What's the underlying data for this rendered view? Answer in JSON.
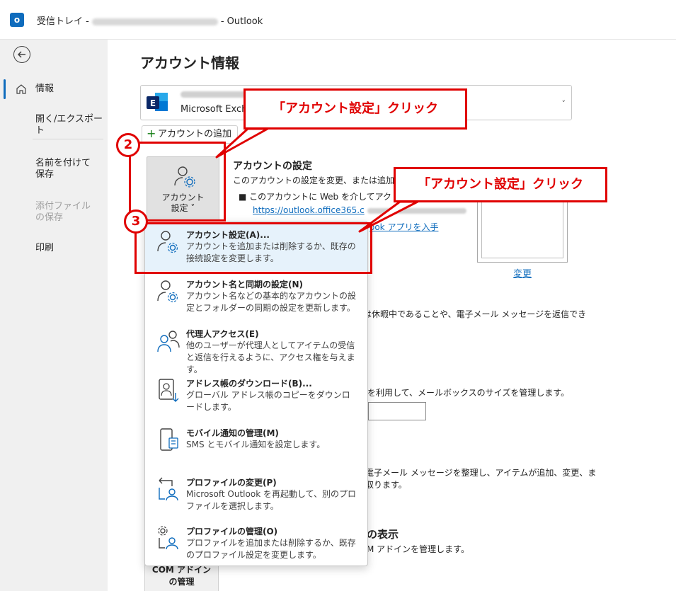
{
  "window": {
    "title_prefix": "受信トレイ -",
    "title_suffix": "-  Outlook"
  },
  "nav": {
    "back_label": "",
    "items": [
      {
        "label": "情報"
      },
      {
        "label": "開く/エクスポート"
      },
      {
        "label": "名前を付けて保存"
      },
      {
        "label": "添付ファイルの保存"
      },
      {
        "label": "印刷"
      }
    ]
  },
  "main": {
    "page_title": "アカウント情報",
    "account_type": "Microsoft Exch",
    "add_account": "アカウントの追加",
    "account_settings_button": {
      "line1": "アカウント",
      "line2": "設定 ˅"
    },
    "account_settings_section": {
      "title": "アカウントの設定",
      "desc": "このアカウントの設定を変更、または追加の",
      "bullet": "■   このアカウントに Web を介してアク",
      "link": "https://outlook.office365.c",
      "link2": "ook アプリを入手"
    },
    "change_link": "変更",
    "auto_reply_text_1": "は休暇中であることや、電子メール メッセージを返信でき",
    "auto_reply_text_2": "。",
    "mailbox_text": "を利用して、メールボックスのサイズを管理します。",
    "rules_text_1": "電子メール メッセージを整理し、アイテムが追加、変更、ま",
    "rules_text_2": "取ります。",
    "com_title": "の表示",
    "com_desc": "M アドインを管理します。",
    "com_button": {
      "line1": "COM アドイン",
      "line2": "の管理"
    }
  },
  "menu": {
    "items": [
      {
        "title": "アカウント設定(A)...",
        "desc": "アカウントを追加または削除するか、既存の接続設定を変更します。"
      },
      {
        "title": "アカウント名と同期の設定(N)",
        "desc": "アカウント名などの基本的なアカウントの設定とフォルダーの同期の設定を更新します。"
      },
      {
        "title": "代理人アクセス(E)",
        "desc": "他のユーザーが代理人としてアイテムの受信と返信を行えるように、アクセス権を与えます。"
      },
      {
        "title": "アドレス帳のダウンロード(B)...",
        "desc": "グローバル アドレス帳のコピーをダウンロードします。"
      },
      {
        "title": "モバイル通知の管理(M)",
        "desc": "SMS とモバイル通知を設定します。"
      },
      {
        "title": "プロファイルの変更(P)",
        "desc": "Microsoft Outlook を再起動して、別のプロファイルを選択します。"
      },
      {
        "title": "プロファイルの管理(O)",
        "desc": "プロファイルを追加または削除するか、既存のプロファイル設定を変更します。"
      }
    ]
  },
  "annotations": {
    "callout_1": "「アカウント設定」クリック",
    "callout_2": "「アカウント設定」クリック",
    "step_2": "2",
    "step_3": "3"
  },
  "colors": {
    "accent": "#0f6cbd",
    "annotation_red": "#e00000",
    "highlight": "#e6f2fb"
  }
}
